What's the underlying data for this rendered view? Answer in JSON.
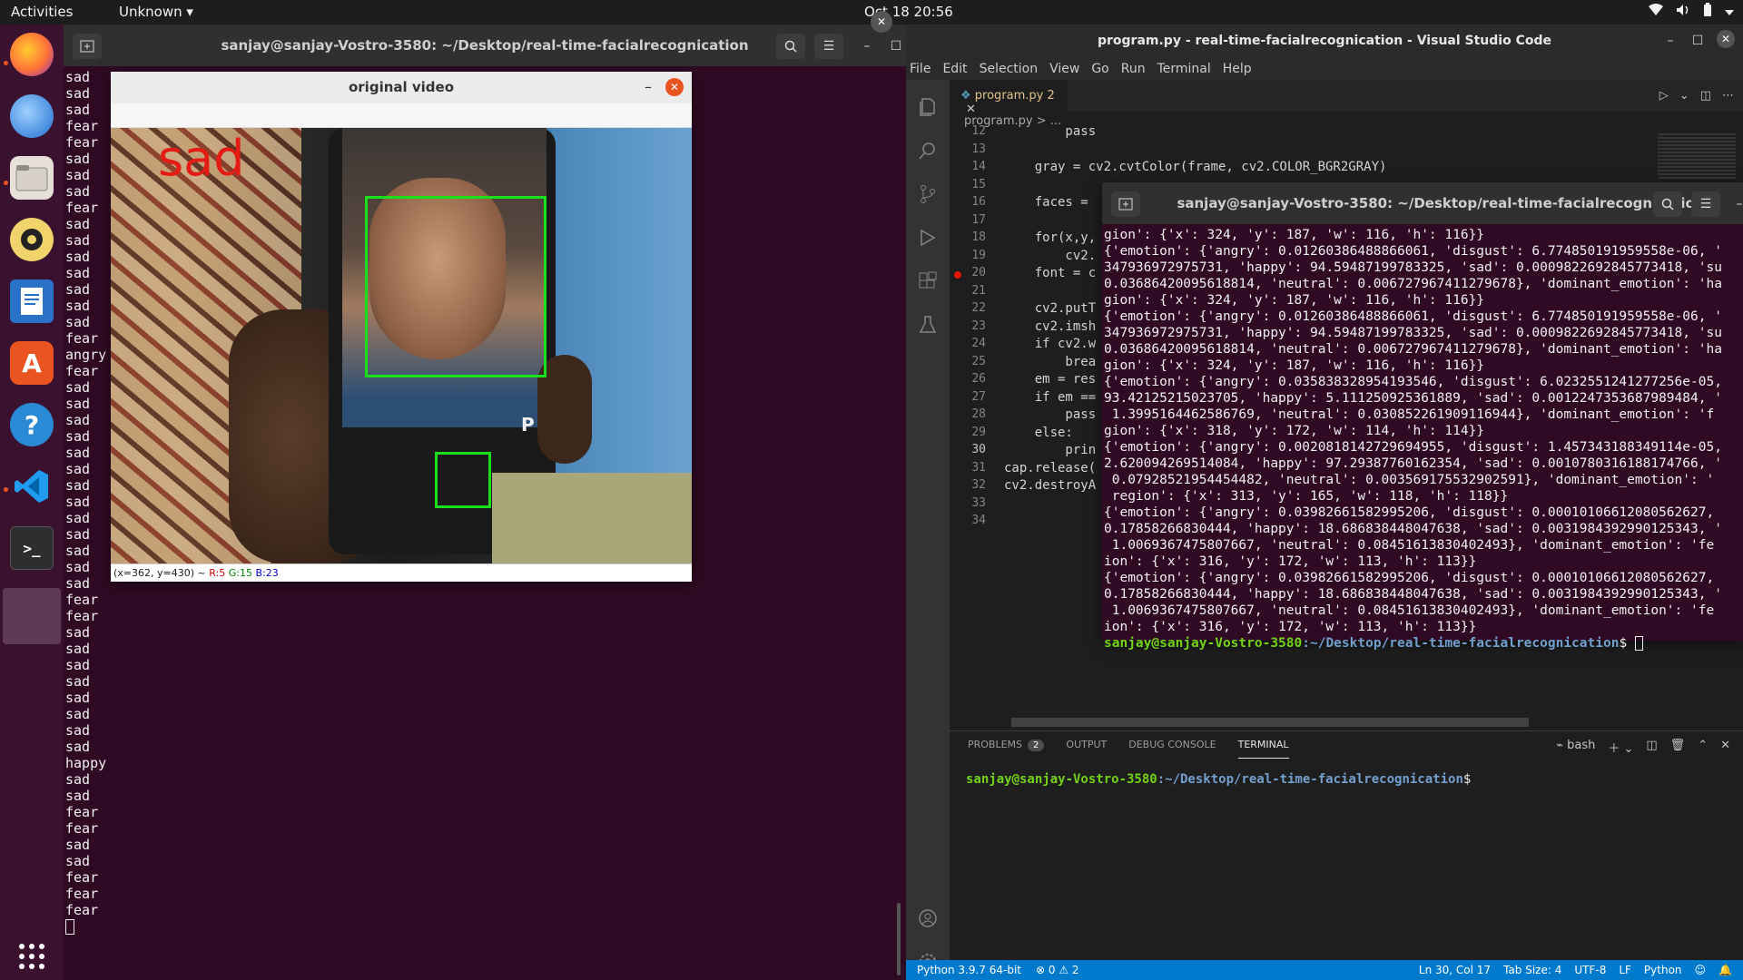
{
  "topbar": {
    "activities": "Activities",
    "app_menu": "Unknown ▾",
    "clock": "Oct 18  20:56"
  },
  "dock": {
    "items": [
      "firefox-icon",
      "thunderbird-icon",
      "files-icon",
      "rhythmbox-icon",
      "libreoffice-writer-icon",
      "software-icon",
      "help-icon",
      "vscode-icon",
      "terminal-icon",
      "open-window-icon"
    ],
    "show_apps": "show-apps-icon"
  },
  "terminal_left": {
    "title": "sanjay@sanjay-Vostro-3580: ~/Desktop/real-time-facialrecognication",
    "lines": [
      "sad",
      "sad",
      "sad",
      "fear",
      "fear",
      "sad",
      "sad",
      "sad",
      "fear",
      "sad",
      "sad",
      "sad",
      "sad",
      "sad",
      "sad",
      "sad",
      "fear",
      "angry",
      "fear",
      "sad",
      "sad",
      "sad",
      "sad",
      "sad",
      "sad",
      "sad",
      "sad",
      "sad",
      "sad",
      "sad",
      "sad",
      "sad",
      "fear",
      "fear",
      "sad",
      "sad",
      "sad",
      "sad",
      "sad",
      "sad",
      "sad",
      "sad",
      "happy",
      "sad",
      "sad",
      "fear",
      "fear",
      "sad",
      "sad",
      "fear",
      "fear",
      "fear"
    ]
  },
  "video_window": {
    "title": "original video",
    "overlay_label": "sad",
    "status": {
      "coords": "(x=362, y=430) ~ ",
      "r": "R:5",
      "g": "G:15",
      "b": "B:23"
    }
  },
  "vscode": {
    "title": "program.py - real-time-facialrecognication - Visual Studio Code",
    "menu": [
      "File",
      "Edit",
      "Selection",
      "View",
      "Go",
      "Run",
      "Terminal",
      "Help"
    ],
    "tab": {
      "label": "program.py",
      "badge": "2"
    },
    "breadcrumb": "program.py > ...",
    "code_lines": [
      {
        "n": "12",
        "text": "        pass"
      },
      {
        "n": "13",
        "text": ""
      },
      {
        "n": "14",
        "text": "    gray = cv2.cvtColor(frame, cv2.COLOR_BGR2GRAY)"
      },
      {
        "n": "15",
        "text": ""
      },
      {
        "n": "16",
        "text": "    faces ="
      },
      {
        "n": "17",
        "text": ""
      },
      {
        "n": "18",
        "text": "    for(x,y,"
      },
      {
        "n": "19",
        "text": "        cv2."
      },
      {
        "n": "20",
        "text": "    font = c"
      },
      {
        "n": "21",
        "text": ""
      },
      {
        "n": "22",
        "text": "    cv2.putT"
      },
      {
        "n": "23",
        "text": "    cv2.imsh"
      },
      {
        "n": "24",
        "text": "    if cv2.w"
      },
      {
        "n": "25",
        "text": "        brea"
      },
      {
        "n": "26",
        "text": "    em = res"
      },
      {
        "n": "27",
        "text": "    if em =="
      },
      {
        "n": "28",
        "text": "        pass"
      },
      {
        "n": "29",
        "text": "    else:"
      },
      {
        "n": "30",
        "text": "        prin"
      },
      {
        "n": "31",
        "text": "cap.release("
      },
      {
        "n": "32",
        "text": "cv2.destroyA"
      },
      {
        "n": "33",
        "text": ""
      },
      {
        "n": "34",
        "text": ""
      }
    ],
    "panel": {
      "tabs": [
        "PROBLEMS",
        "OUTPUT",
        "DEBUG CONSOLE",
        "TERMINAL"
      ],
      "problems_count": "2",
      "shell": "bash",
      "prompt_user": "sanjay@sanjay-Vostro-3580",
      "prompt_path": ":~/Desktop/real-time-facialrecognication",
      "prompt_end": "$"
    },
    "status": {
      "python": "Python 3.9.7 64-bit",
      "problems": "⊗ 0 ⚠ 2",
      "position": "Ln 30, Col 17",
      "tab_size": "Tab Size: 4",
      "encoding": "UTF-8",
      "eol": "LF",
      "language": "Python"
    }
  },
  "terminal_float": {
    "title": "sanjay@sanjay-Vostro-3580: ~/Desktop/real-time-facialrecognication",
    "lines": [
      "gion': {'x': 324, 'y': 187, 'w': 116, 'h': 116}}",
      "{'emotion': {'angry': 0.01260386488866061, 'disgust': 6.774850191959558e-06, '",
      "347936972975731, 'happy': 94.59487199783325, 'sad': 0.0009822692845773418, 'su",
      "0.03686420095618814, 'neutral': 0.006727967411279678}, 'dominant_emotion': 'ha",
      "gion': {'x': 324, 'y': 187, 'w': 116, 'h': 116}}",
      "{'emotion': {'angry': 0.01260386488866061, 'disgust': 6.774850191959558e-06, '",
      "347936972975731, 'happy': 94.59487199783325, 'sad': 0.0009822692845773418, 'su",
      "0.03686420095618814, 'neutral': 0.006727967411279678}, 'dominant_emotion': 'ha",
      "gion': {'x': 324, 'y': 187, 'w': 116, 'h': 116}}",
      "{'emotion': {'angry': 0.035838328954193546, 'disgust': 6.023255124127725​6e-05,",
      "93.42125215023705, 'happy': 5.111250925361889, 'sad': 0.0012247353687989484, '",
      " 1.3995164462586769, 'neutral': 0.030852261909116944}, 'dominant_emotion': 'f",
      "gion': {'x': 318, 'y': 172, 'w': 114, 'h': 114}}",
      "{'emotion': {'angry': 0.0020818142729694955, 'disgust': 1.457343188349114e-05,",
      "2.620094269514084, 'happy': 97.29387760162354, 'sad': 0.0010780316188174766, '",
      " 0.07928521954454482, 'neutral': 0.003569175532902591}, 'dominant_emotion': '",
      " region': {'x': 313, 'y': 165, 'w': 118, 'h': 118}}",
      "{'emotion': {'angry': 0.03982661582995206, 'disgust': 0.00010106612080562627,",
      "0.17858266830444, 'happy': 18.686838448047638, 'sad': 0.003198439299012534​3, '",
      " 1.0069367475807667, 'neutral': 0.08451613830402493}, 'dominant_emotion': 'fe",
      "ion': {'x': 316, 'y': 172, 'w': 113, 'h': 113}}",
      "{'emotion': {'angry': 0.03982661582995206, 'disgust': 0.00010106612080562627,",
      "0.17858266830444, 'happy': 18.686838448047638, 'sad': 0.003198439299012534​3, '",
      " 1.0069367475807667, 'neutral': 0.08451613830402493}, 'dominant_emotion': 'fe",
      "ion': {'x': 316, 'y': 172, 'w': 113, 'h': 113}}"
    ],
    "prompt_user": "sanjay@sanjay-Vostro-3580",
    "prompt_path": ":~/Desktop/real-time-facialrecognication",
    "prompt_end": "$ "
  }
}
